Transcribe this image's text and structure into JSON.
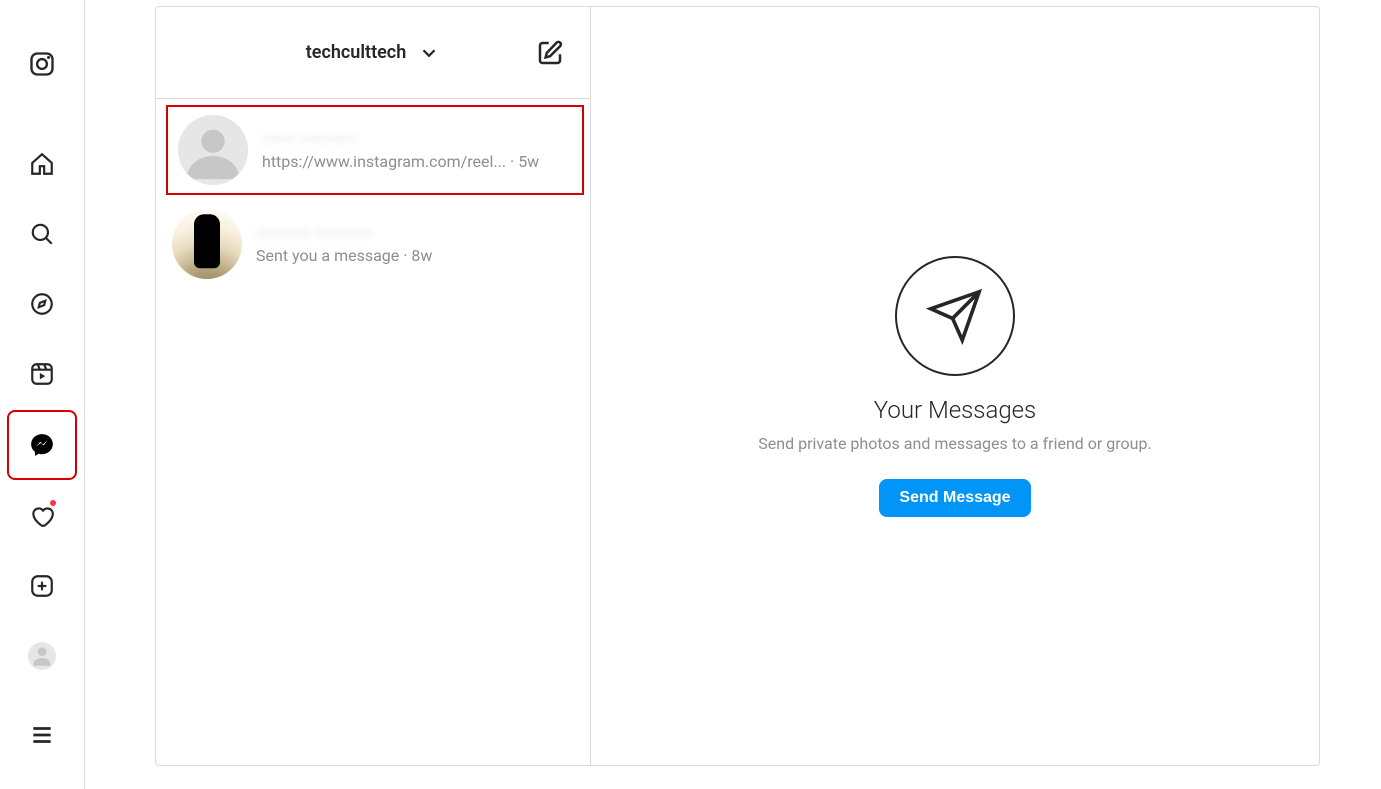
{
  "inbox": {
    "account_username": "techculttech",
    "conversations": [
      {
        "name": "––– –––––",
        "preview": "https://www.instagram.com/reel...",
        "time": "5w"
      },
      {
        "name": "––––– –––––",
        "preview": "Sent you a message",
        "time": "8w"
      }
    ]
  },
  "empty_state": {
    "title": "Your Messages",
    "subtitle": "Send private photos and messages to a friend or group.",
    "button_label": "Send Message"
  }
}
